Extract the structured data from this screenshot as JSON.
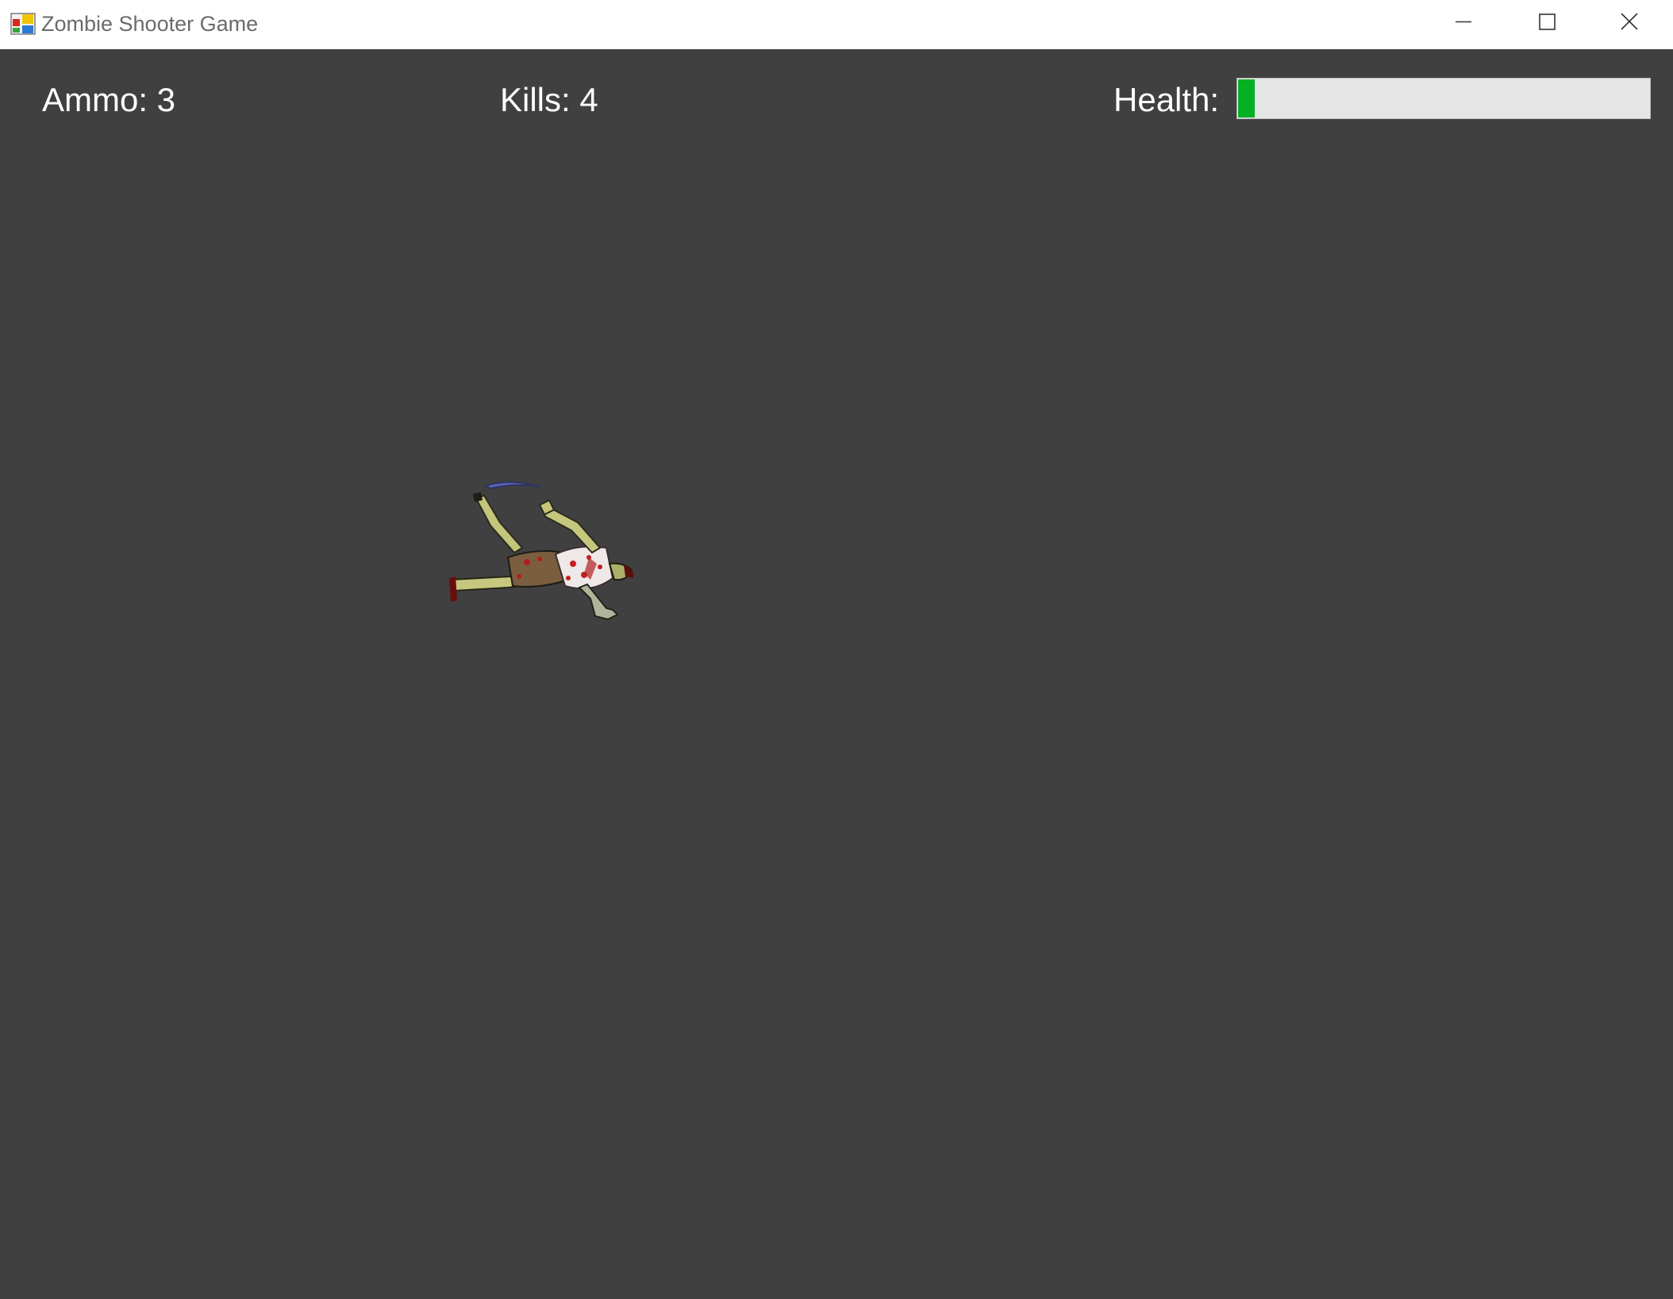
{
  "window": {
    "title": "Zombie Shooter Game",
    "icon": "app-window-icon",
    "controls": [
      "minimize-icon",
      "maximize-icon",
      "close-icon"
    ]
  },
  "hud": {
    "ammo_text": "Ammo: 3",
    "kills_text": "Kills: 4",
    "health_label": "Health:",
    "health_fraction": 0.04,
    "health_color": "#06b025",
    "health_track_color": "#e6e6e6"
  },
  "scene": {
    "background_color": "#404040",
    "sprites": [
      "dead-zombie"
    ]
  }
}
